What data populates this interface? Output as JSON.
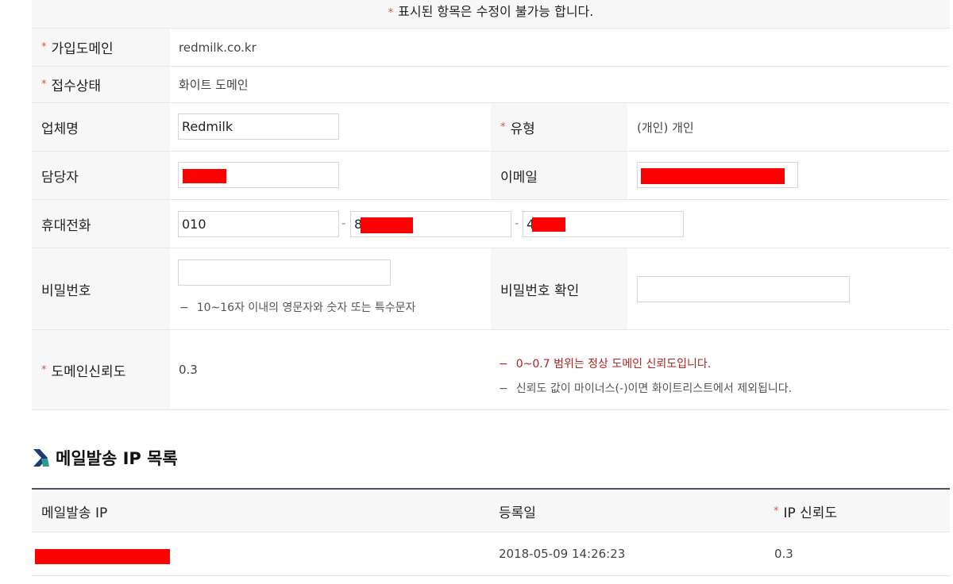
{
  "notice": {
    "star": "*",
    "text": "표시된 항목은 수정이 불가능 합니다."
  },
  "form": {
    "domain": {
      "label": "가입도메인",
      "value": "redmilk.co.kr"
    },
    "status": {
      "label": "접수상태",
      "value": "화이트 도메인"
    },
    "company": {
      "label": "업체명",
      "value": "Redmilk"
    },
    "type": {
      "label": "유형",
      "value": "(개인) 개인"
    },
    "manager": {
      "label": "담당자",
      "value": ""
    },
    "email": {
      "label": "이메일",
      "value": ""
    },
    "phone": {
      "label": "휴대전화",
      "part1": "010",
      "part2": "8",
      "part3": "4",
      "separator": "-"
    },
    "password": {
      "label": "비밀번호",
      "hint": "10~16자 이내의 영문자와 숫자 또는 특수문자",
      "hint_dash": "−"
    },
    "password_confirm": {
      "label": "비밀번호 확인"
    },
    "trust": {
      "label": "도메인신뢰도",
      "value": "0.3",
      "hint1": "0~0.7 범위는 정상 도메인 신뢰도입니다.",
      "hint2": "신뢰도 값이 마이너스(-)이면 화이트리스트에서 제외됩니다.",
      "hint_dash": "−"
    }
  },
  "ip_section": {
    "title": "메일발송 IP 목록",
    "columns": [
      "메일발송 IP",
      "등록일",
      "IP 신뢰도"
    ],
    "rows": [
      {
        "ip": "",
        "date": "2018-05-09 14:26:23",
        "trust": "0.3"
      }
    ]
  },
  "colors": {
    "accent_red": "#d9534f",
    "redaction": "#ff0000",
    "header_border": "#4a5360",
    "icon_green": "#2a9d8f",
    "icon_navy": "#1f3b73"
  }
}
